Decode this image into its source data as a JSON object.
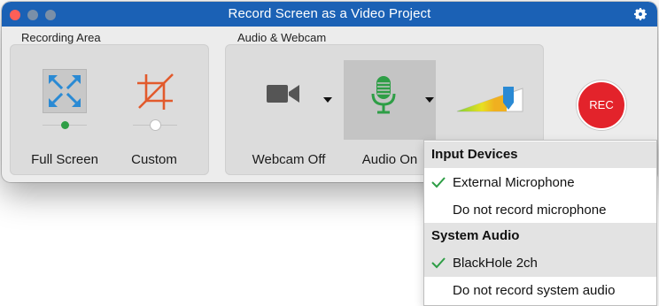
{
  "window": {
    "title": "Record Screen as a Video Project",
    "icons": {
      "close": "close-dot",
      "minimize": "minimize-dot",
      "maximize": "maximize-dot",
      "settings": "gear-icon"
    }
  },
  "recording_area": {
    "section_label": "Recording Area",
    "options": [
      {
        "label": "Full Screen",
        "icon": "fullscreen-arrows-icon",
        "selected": true
      },
      {
        "label": "Custom",
        "icon": "crop-icon",
        "selected": false
      }
    ]
  },
  "audio_webcam": {
    "section_label": "Audio & Webcam",
    "webcam": {
      "label": "Webcam Off",
      "icon": "video-camera-icon"
    },
    "audio": {
      "label": "Audio On",
      "icon": "microphone-icon",
      "active": true
    },
    "volume": {
      "icon": "volume-slider-icon"
    }
  },
  "rec_button": {
    "label": "REC",
    "color": "#e3232b"
  },
  "audio_menu": {
    "sections": [
      {
        "header": "Input Devices",
        "items": [
          {
            "label": "External Microphone",
            "checked": true
          },
          {
            "label": "Do not record microphone",
            "checked": false
          }
        ]
      },
      {
        "header": "System Audio",
        "items": [
          {
            "label": "BlackHole 2ch",
            "checked": true
          },
          {
            "label": "Do not record system audio",
            "checked": false
          }
        ]
      }
    ]
  },
  "colors": {
    "titlebar": "#1b61b5",
    "accent_blue": "#2a8ad4",
    "crop_orange": "#e25a2c",
    "mic_green": "#2e9e46",
    "checkmark_green": "#2e9e46"
  }
}
